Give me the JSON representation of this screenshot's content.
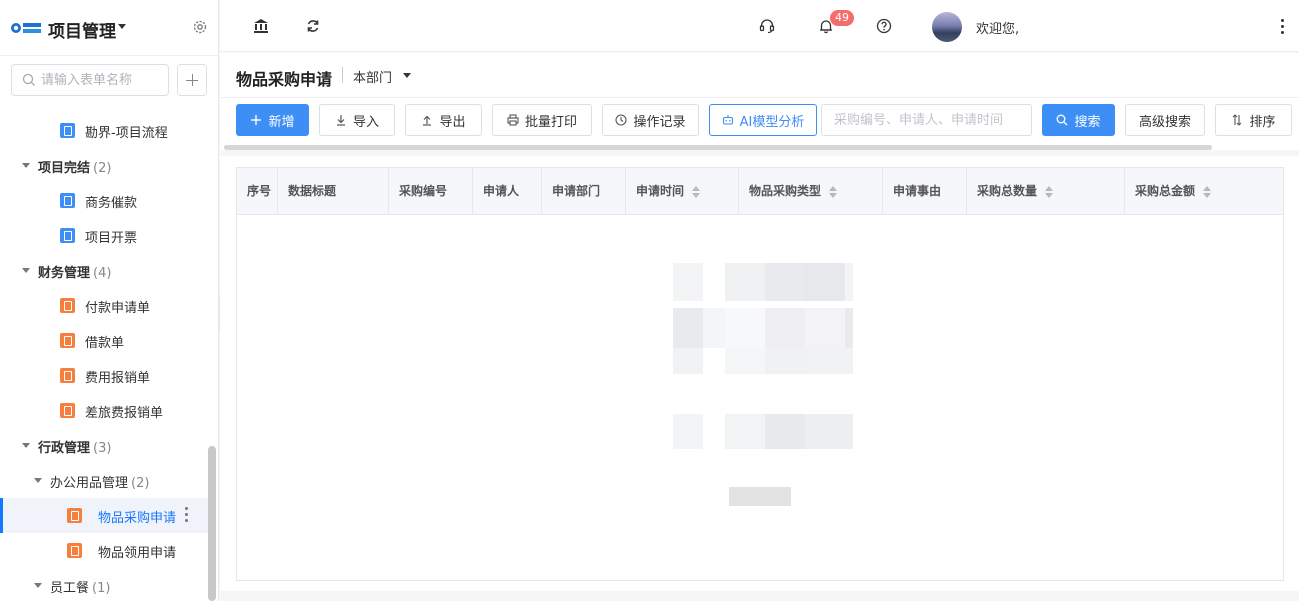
{
  "app": {
    "title": "项目管理"
  },
  "sidebar": {
    "search_placeholder": "请输入表单名称",
    "items": {
      "kanjie": "勘界-项目流程",
      "xmwj": {
        "label": "项目完结",
        "count": "(2)"
      },
      "swcj": "商务催款",
      "xmkp": "项目开票",
      "cwgl": {
        "label": "财务管理",
        "count": "(4)"
      },
      "fksqd": "付款申请单",
      "jkd": "借款单",
      "fybxd": "费用报销单",
      "clfbxd": "差旅费报销单",
      "xzgl": {
        "label": "行政管理",
        "count": "(3)"
      },
      "bgyp": {
        "label": "办公用品管理",
        "count": "(2)"
      },
      "wpcg": "物品采购申请",
      "wply": "物品领用申请",
      "ygc": {
        "label": "员工餐",
        "count": "(1)"
      }
    }
  },
  "topbar": {
    "notification_count": "49",
    "welcome": "欢迎您,"
  },
  "page": {
    "title": "物品采购申请",
    "scope": "本部门"
  },
  "toolbar": {
    "add": "新增",
    "import": "导入",
    "export": "导出",
    "batch_print": "批量打印",
    "operation_log": "操作记录",
    "ai_analysis": "AI模型分析",
    "search_placeholder": "采购编号、申请人、申请时间",
    "search": "搜索",
    "advanced_search": "高级搜索",
    "sort": "排序"
  },
  "table": {
    "columns": [
      "序号",
      "数据标题",
      "采购编号",
      "申请人",
      "申请部门",
      "申请时间",
      "物品采购类型",
      "申请事由",
      "采购总数量",
      "采购总金额"
    ]
  },
  "colors": {
    "primary": "#3d8ef5",
    "badge": "#f56c6c",
    "icon_blue": "#3d8ef5",
    "icon_orange": "#f5803e"
  }
}
